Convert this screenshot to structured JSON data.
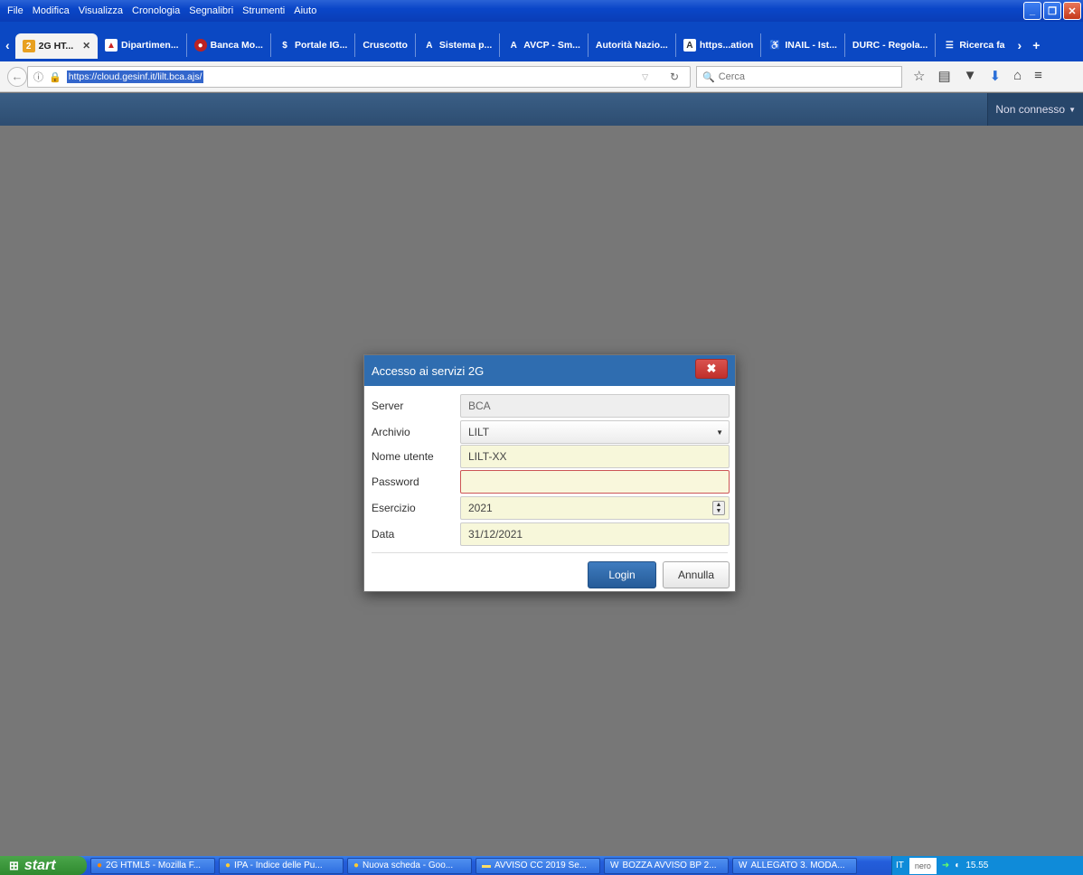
{
  "browser": {
    "menu": [
      "File",
      "Modifica",
      "Visualizza",
      "Cronologia",
      "Segnalibri",
      "Strumenti",
      "Aiuto"
    ],
    "tabs": [
      {
        "label": "2G HT...",
        "icon": "2g-logo-icon",
        "active": true
      },
      {
        "label": "Dipartimen...",
        "icon": "pdf-icon"
      },
      {
        "label": "Banca Mo...",
        "icon": "bank-icon"
      },
      {
        "label": "Portale IG...",
        "icon": "dollar-icon"
      },
      {
        "label": "Cruscotto",
        "icon": ""
      },
      {
        "label": "Sistema p...",
        "icon": "avcp-icon"
      },
      {
        "label": "AVCP - Sm...",
        "icon": "avcp-icon"
      },
      {
        "label": "Autorità Nazio...",
        "icon": ""
      },
      {
        "label": "https...ation",
        "icon": "avcp-icon"
      },
      {
        "label": "INAIL - Ist...",
        "icon": "inail-icon"
      },
      {
        "label": "DURC - Regola...",
        "icon": ""
      },
      {
        "label": "Ricerca fa",
        "icon": "list-icon"
      }
    ],
    "url": "https://cloud.gesinf.it/lilt.bca.ajs/",
    "search_placeholder": "Cerca"
  },
  "appbar": {
    "connection_status": "Non connesso"
  },
  "dialog": {
    "title": "Accesso ai servizi 2G",
    "fields": [
      {
        "label": "Server",
        "value": "BCA"
      },
      {
        "label": "Archivio",
        "value": "LILT"
      },
      {
        "label": "Nome utente",
        "value": "LILT-XX"
      },
      {
        "label": "Password",
        "value": ""
      },
      {
        "label": "Esercizio",
        "value": "2021"
      },
      {
        "label": "Data",
        "value": "31/12/2021"
      }
    ],
    "login_label": "Login",
    "cancel_label": "Annulla"
  },
  "taskbar": {
    "start_label": "start",
    "tasks": [
      "2G HTML5 - Mozilla F...",
      "IPA - Indice delle Pu...",
      "Nuova scheda - Goo...",
      "AVVISO CC 2019 Se...",
      "BOZZA AVVISO BP 2...",
      "ALLEGATO 3. MODA..."
    ],
    "language": "IT",
    "nero_label": "nero",
    "clock": "15.55"
  },
  "colors": {
    "appbar": "#2d4d71",
    "dialog_header": "#2f6db0",
    "login_button": "#255b98",
    "close_button": "#c0302b",
    "field_background": "#f7f7da",
    "workspace": "#777777"
  }
}
